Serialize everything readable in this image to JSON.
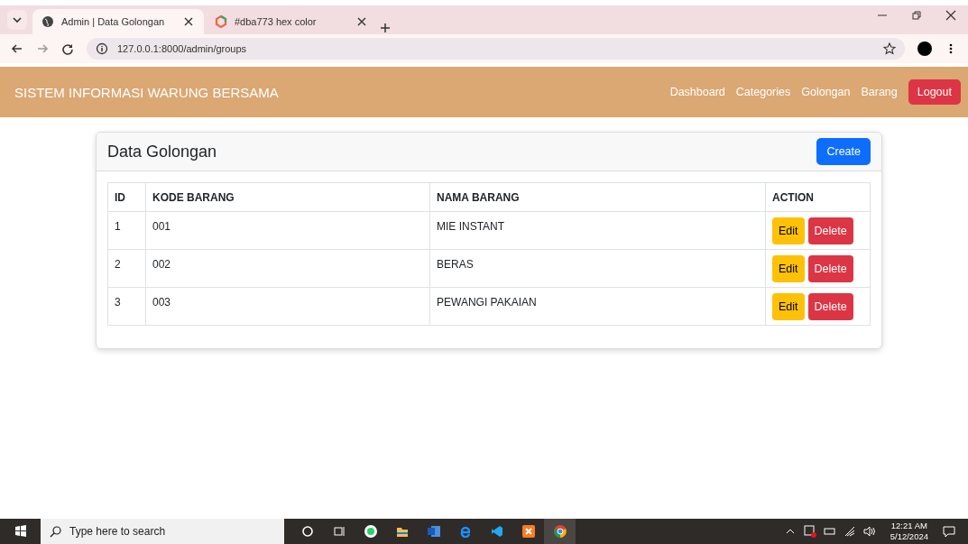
{
  "browser": {
    "tabs": [
      {
        "title": "Admin | Data Golongan",
        "selected": true
      },
      {
        "title": "#dba773 hex color",
        "selected": false
      }
    ],
    "address": "127.0.0.1:8000/admin/groups"
  },
  "navbar": {
    "brand": "SISTEM INFORMASI WARUNG BERSAMA",
    "links": [
      "Dashboard",
      "Categories",
      "Golongan",
      "Barang"
    ],
    "logout": "Logout"
  },
  "card": {
    "title": "Data Golongan",
    "create_button": "Create",
    "table": {
      "columns": [
        "ID",
        "KODE BARANG",
        "NAMA BARANG",
        "ACTION"
      ],
      "rows": [
        {
          "id": "1",
          "kode": "001",
          "nama": "MIE INSTANT",
          "actions": [
            "Edit",
            "Delete"
          ]
        },
        {
          "id": "2",
          "kode": "002",
          "nama": "BERAS",
          "actions": [
            "Edit",
            "Delete"
          ]
        },
        {
          "id": "3",
          "kode": "003",
          "nama": "PEWANGI PAKAIAN",
          "actions": [
            "Edit",
            "Delete"
          ]
        }
      ]
    }
  },
  "taskbar": {
    "search_placeholder": "Type here to search",
    "time": "12:21 AM",
    "date": "5/12/2024"
  }
}
